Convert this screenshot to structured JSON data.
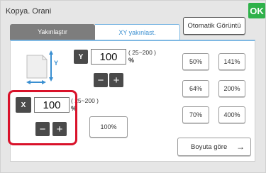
{
  "window": {
    "title": "Kopya. Orani",
    "ok_label": "OK"
  },
  "toolbar": {
    "auto_view_label": "Otomatik Görüntü"
  },
  "tabs": [
    {
      "label": "Yakınlaştır",
      "active": false
    },
    {
      "label": "XY yakınlast.",
      "active": true
    }
  ],
  "y_axis": {
    "badge": "Y",
    "value": "100",
    "range": "( 25~200 )",
    "unit": "%"
  },
  "x_axis": {
    "badge": "X",
    "value": "100",
    "range": "( 25~200 )",
    "unit": "%"
  },
  "stepper": {
    "minus": "−",
    "plus": "+"
  },
  "presets": [
    "50%",
    "141%",
    "64%",
    "200%",
    "70%",
    "400%"
  ],
  "reset_button": "100%",
  "fit_button": {
    "label": "Boyuta göre",
    "arrow": "→"
  },
  "icons": [
    "page-size-icon",
    "right-arrow-icon"
  ],
  "colors": {
    "ok_green": "#2fb14a",
    "tab_active_text": "#3a8fd1",
    "highlight_red": "#d9122a",
    "dark_control": "#4a4a4a"
  }
}
